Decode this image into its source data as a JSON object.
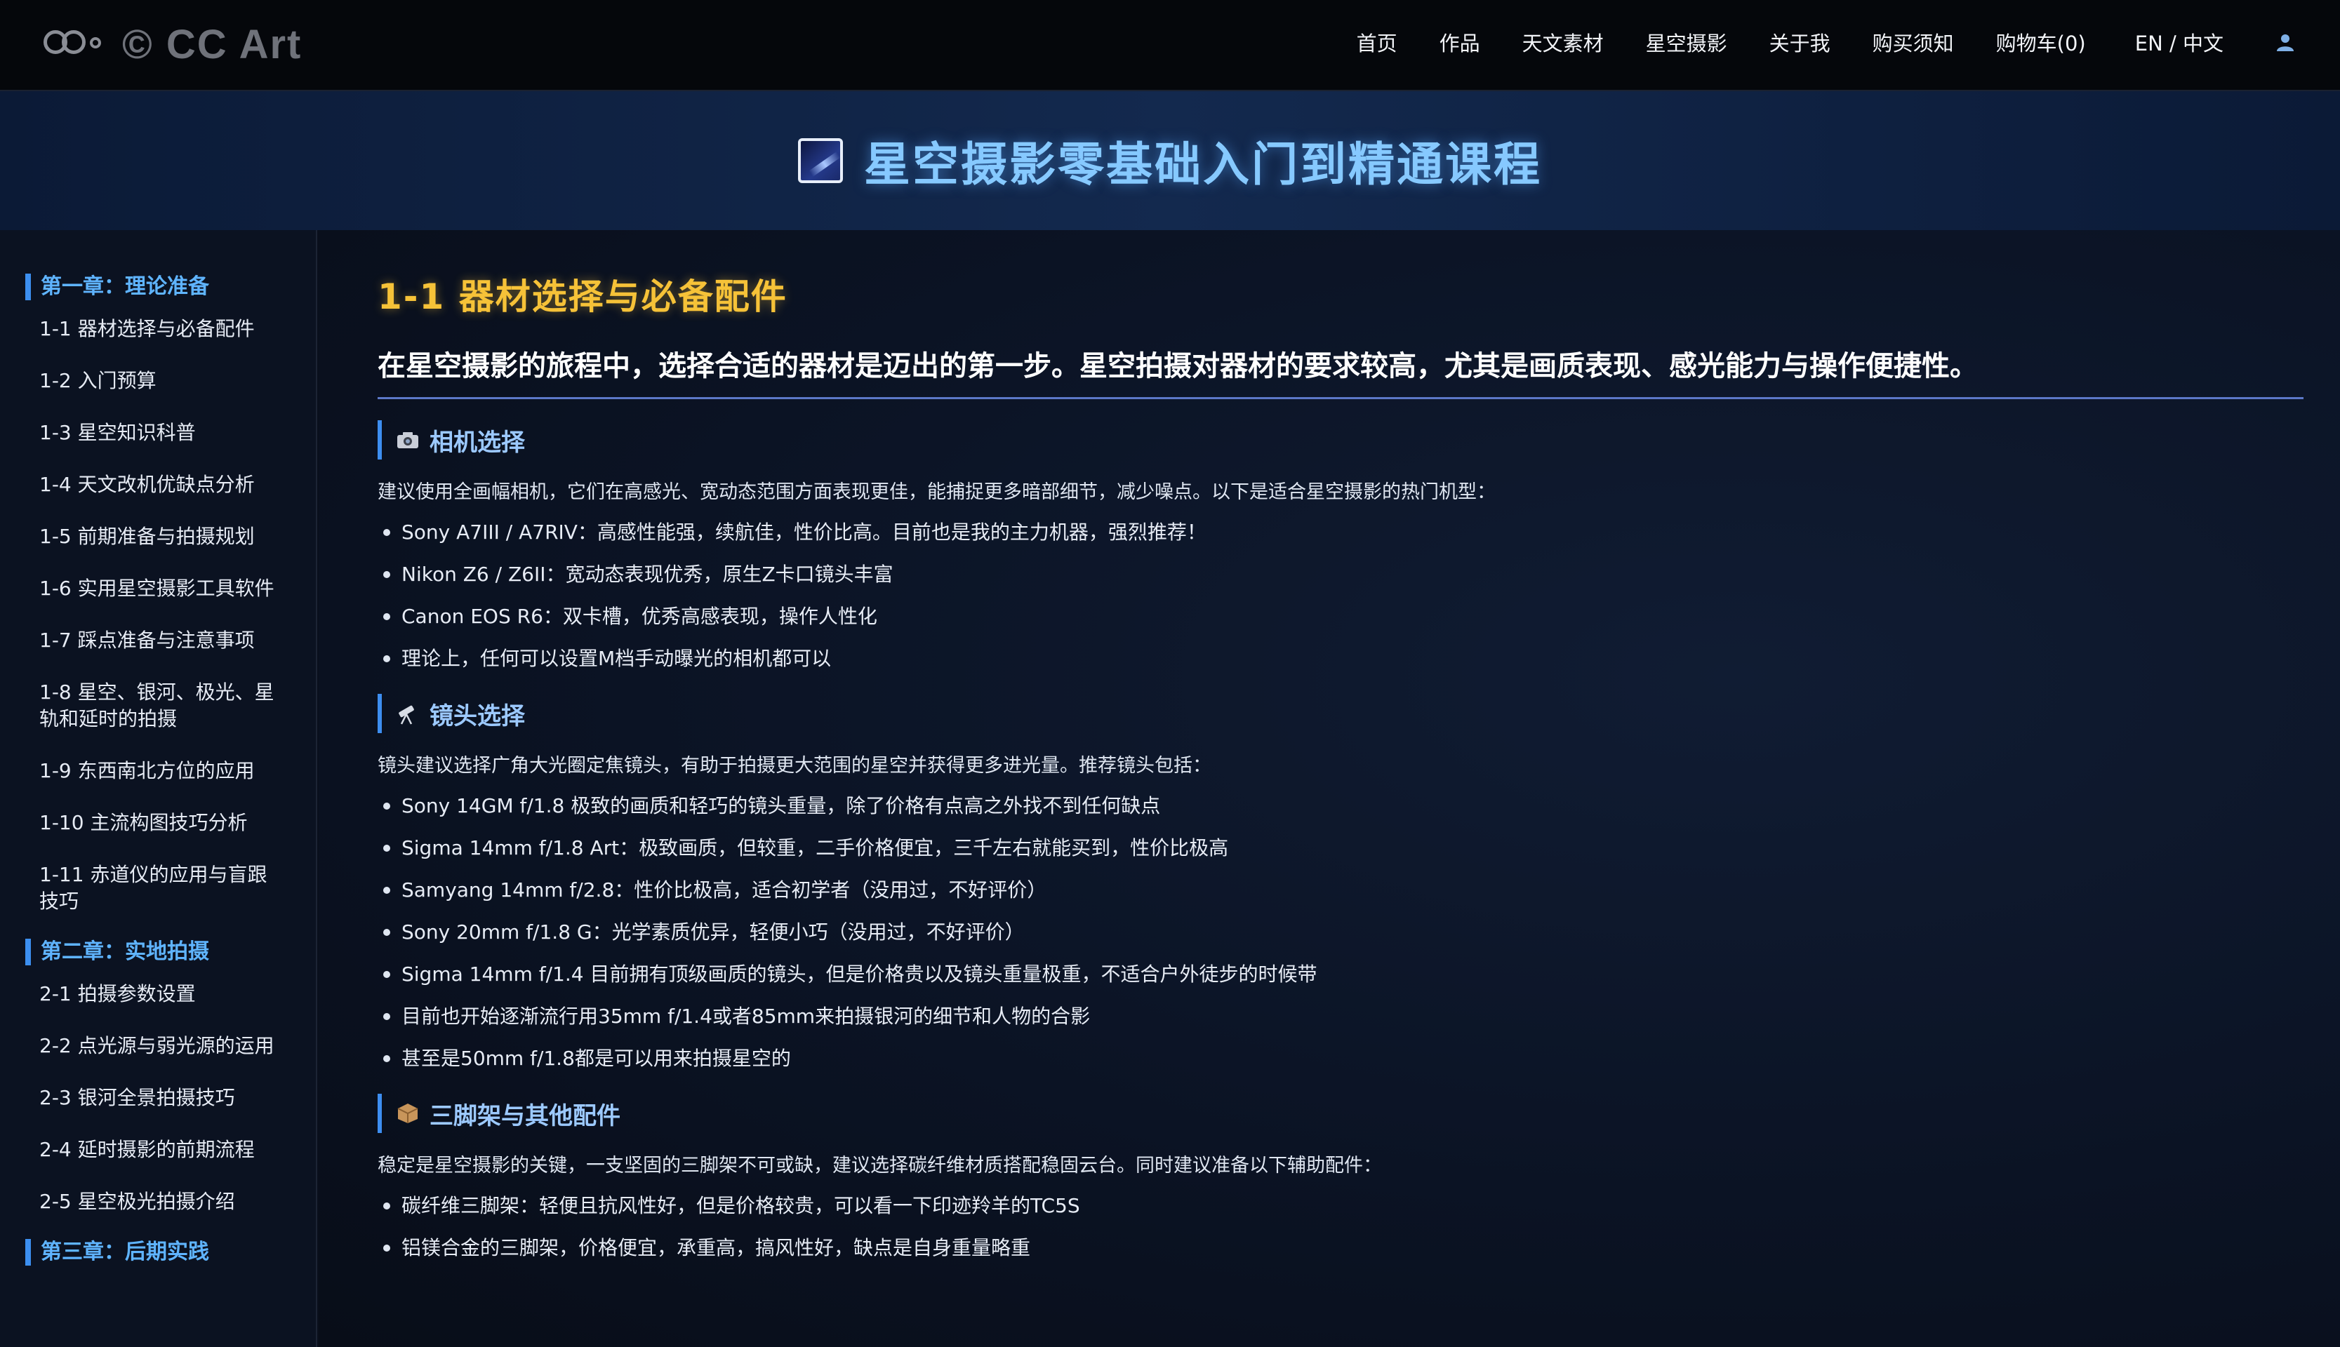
{
  "header": {
    "logo_text": "© CC Art",
    "nav": [
      "首页",
      "作品",
      "天文素材",
      "星空摄影",
      "关于我",
      "购买须知",
      "购物车(0)"
    ],
    "lang": "EN / 中文",
    "user_icon": "user-icon"
  },
  "banner": {
    "icon": "milky-way-image-icon",
    "title": "星空摄影零基础入门到精通课程"
  },
  "sidebar": {
    "chapters": [
      {
        "title": "第一章：理论准备",
        "lessons": [
          "1-1 器材选择与必备配件",
          "1-2 入门预算",
          "1-3 星空知识科普",
          "1-4 天文改机优缺点分析",
          "1-5 前期准备与拍摄规划",
          "1-6 实用星空摄影工具软件",
          "1-7 踩点准备与注意事项",
          "1-8 星空、银河、极光、星轨和延时的拍摄",
          "1-9 东西南北方位的应用",
          "1-10 主流构图技巧分析",
          "1-11 赤道仪的应用与盲跟技巧"
        ]
      },
      {
        "title": "第二章：实地拍摄",
        "lessons": [
          "2-1 拍摄参数设置",
          "2-2 点光源与弱光源的运用",
          "2-3 银河全景拍摄技巧",
          "2-4 延时摄影的前期流程",
          "2-5 星空极光拍摄介绍"
        ]
      },
      {
        "title": "第三章：后期实践",
        "lessons": []
      }
    ]
  },
  "main": {
    "lesson_title": "1-1 器材选择与必备配件",
    "intro": "在星空摄影的旅程中，选择合适的器材是迈出的第一步。星空拍摄对器材的要求较高，尤其是画质表现、感光能力与操作便捷性。",
    "sections": [
      {
        "icon": "camera-icon",
        "heading": "相机选择",
        "desc": "建议使用全画幅相机，它们在高感光、宽动态范围方面表现更佳，能捕捉更多暗部细节，减少噪点。以下是适合星空摄影的热门机型：",
        "items": [
          "Sony A7III / A7RIV：高感性能强，续航佳，性价比高。目前也是我的主力机器，强烈推荐！",
          "Nikon Z6 / Z6II：宽动态表现优秀，原生Z卡口镜头丰富",
          "Canon EOS R6：双卡槽，优秀高感表现，操作人性化",
          "理论上，任何可以设置M档手动曝光的相机都可以"
        ]
      },
      {
        "icon": "telescope-icon",
        "heading": "镜头选择",
        "desc": "镜头建议选择广角大光圈定焦镜头，有助于拍摄更大范围的星空并获得更多进光量。推荐镜头包括：",
        "items": [
          "Sony 14GM f/1.8 极致的画质和轻巧的镜头重量，除了价格有点高之外找不到任何缺点",
          "Sigma 14mm f/1.8 Art：极致画质，但较重，二手价格便宜，三千左右就能买到，性价比极高",
          "Samyang 14mm f/2.8：性价比极高，适合初学者（没用过，不好评价）",
          "Sony 20mm f/1.8 G：光学素质优异，轻便小巧（没用过，不好评价）",
          "Sigma 14mm f/1.4 目前拥有顶级画质的镜头，但是价格贵以及镜头重量极重，不适合户外徒步的时候带",
          "目前也开始逐渐流行用35mm f/1.4或者85mm来拍摄银河的细节和人物的合影",
          "甚至是50mm f/1.8都是可以用来拍摄星空的"
        ]
      },
      {
        "icon": "package-icon",
        "heading": "三脚架与其他配件",
        "desc": "稳定是星空摄影的关键，一支坚固的三脚架不可或缺，建议选择碳纤维材质搭配稳固云台。同时建议准备以下辅助配件：",
        "items": [
          "碳纤维三脚架：轻便且抗风性好，但是价格较贵，可以看一下印迹羚羊的TC5S",
          "铝镁合金的三脚架，价格便宜，承重高，搞风性好，缺点是自身重量略重"
        ]
      }
    ]
  }
}
